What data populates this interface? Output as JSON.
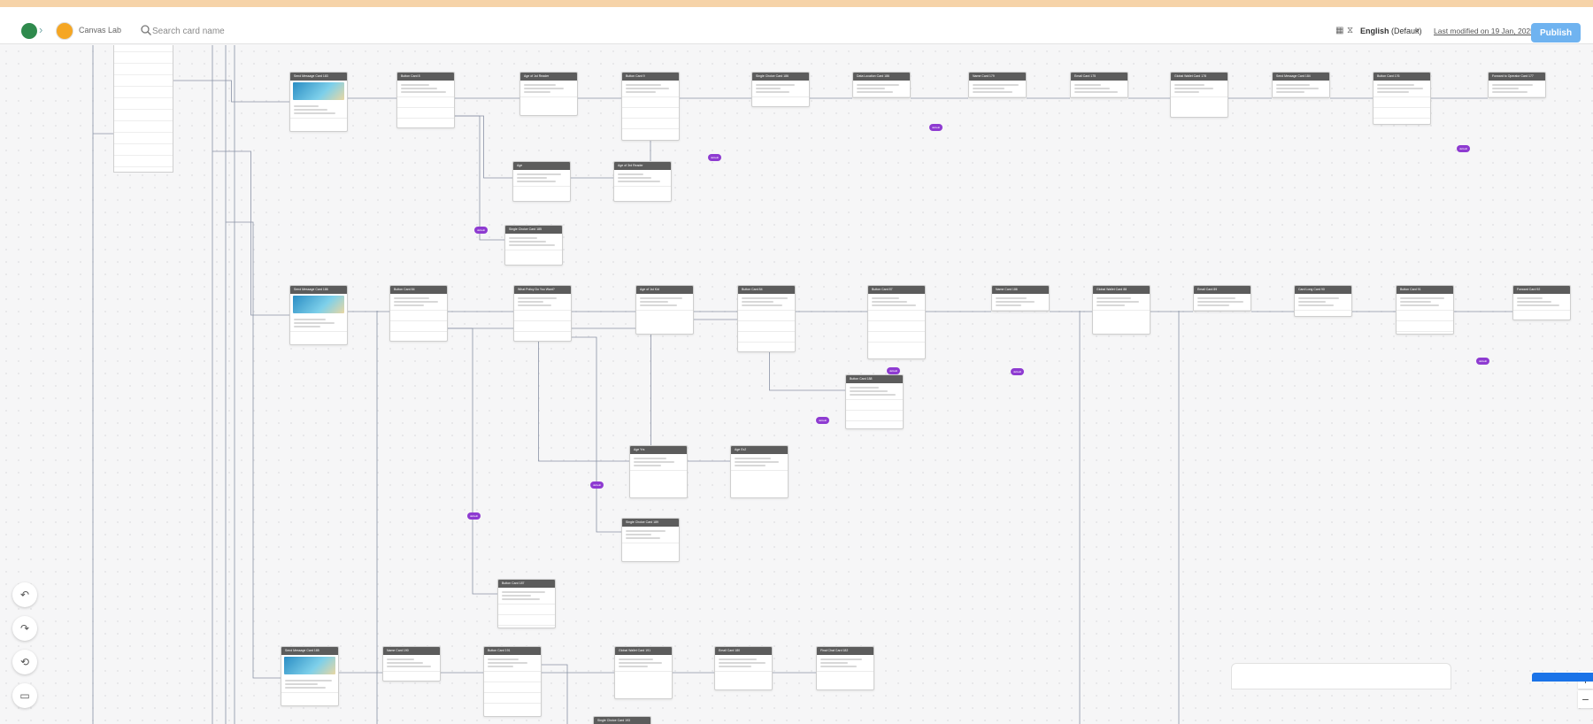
{
  "header": {
    "brand_name": "Canvas Lab",
    "search_placeholder": "Search card name",
    "language": "English",
    "language_suffix": " (Default)",
    "last_modified": "Last modified on 19 Jan, 2025",
    "publish_label": "Publish"
  },
  "toolbar": {
    "undo_icon": "undo-icon",
    "redo_icon": "redo-icon",
    "reset_icon": "reset-icon",
    "preview_icon": "preview-icon",
    "zoom_in_label": "+",
    "zoom_out_label": "−"
  },
  "canvas": {
    "badge_label": "default",
    "cards": [
      {
        "title": "Send Message Card 183",
        "kind": "image"
      },
      {
        "title": "Button Card 8",
        "kind": "buttons"
      },
      {
        "title": "Age of 1st Reader",
        "kind": "text"
      },
      {
        "title": "Button Card 9",
        "kind": "buttons"
      },
      {
        "title": "Single Choice Card 186",
        "kind": "text"
      },
      {
        "title": "Data Location Card 186",
        "kind": "text"
      },
      {
        "title": "Name Card 179",
        "kind": "text"
      },
      {
        "title": "Email Card 175",
        "kind": "text"
      },
      {
        "title": "Global Wallet Card 178",
        "kind": "text"
      },
      {
        "title": "Send Message Card 184",
        "kind": "text"
      },
      {
        "title": "Button Card 176",
        "kind": "buttons"
      },
      {
        "title": "Forward to Operator Card 177",
        "kind": "text"
      },
      {
        "title": "Age",
        "kind": "text"
      },
      {
        "title": "Age of 3rd Reader",
        "kind": "text"
      },
      {
        "title": "Single Choice Card 185",
        "kind": "text"
      },
      {
        "title": "Send Message Card 186",
        "kind": "image"
      },
      {
        "title": "Button Card 84",
        "kind": "buttons"
      },
      {
        "title": "What Policy Do You Want?",
        "kind": "buttons"
      },
      {
        "title": "Age of 1st Kid",
        "kind": "text"
      },
      {
        "title": "Button Card 84",
        "kind": "buttons"
      },
      {
        "title": "Button Card 87",
        "kind": "buttons"
      },
      {
        "title": "Name Card 186",
        "kind": "text"
      },
      {
        "title": "Global Wallet Card 88",
        "kind": "text"
      },
      {
        "title": "Email Card 89",
        "kind": "text"
      },
      {
        "title": "Card Long Card 90",
        "kind": "text"
      },
      {
        "title": "Button Card 91",
        "kind": "buttons"
      },
      {
        "title": "Forward Card 92",
        "kind": "text"
      },
      {
        "title": "Button Card 188",
        "kind": "buttons"
      },
      {
        "title": "Age Yrs",
        "kind": "text"
      },
      {
        "title": "Age Ex2",
        "kind": "text"
      },
      {
        "title": "Single Choice Card 189",
        "kind": "text"
      },
      {
        "title": "Button Card 187",
        "kind": "buttons"
      },
      {
        "title": "Send Message Card 185",
        "kind": "image"
      },
      {
        "title": "Name Card 190",
        "kind": "text"
      },
      {
        "title": "Button Card 191",
        "kind": "buttons"
      },
      {
        "title": "Global Wallet Card 191",
        "kind": "text"
      },
      {
        "title": "Email Card 180",
        "kind": "text"
      },
      {
        "title": "Final Chat Card 182",
        "kind": "text"
      },
      {
        "title": "Single Choice Card 193",
        "kind": "text"
      }
    ]
  },
  "colors": {
    "publish": "#6fb3f0",
    "badge": "#8e3bd1",
    "card_header": "#5c5c5c",
    "connector": "#8a93a6"
  }
}
